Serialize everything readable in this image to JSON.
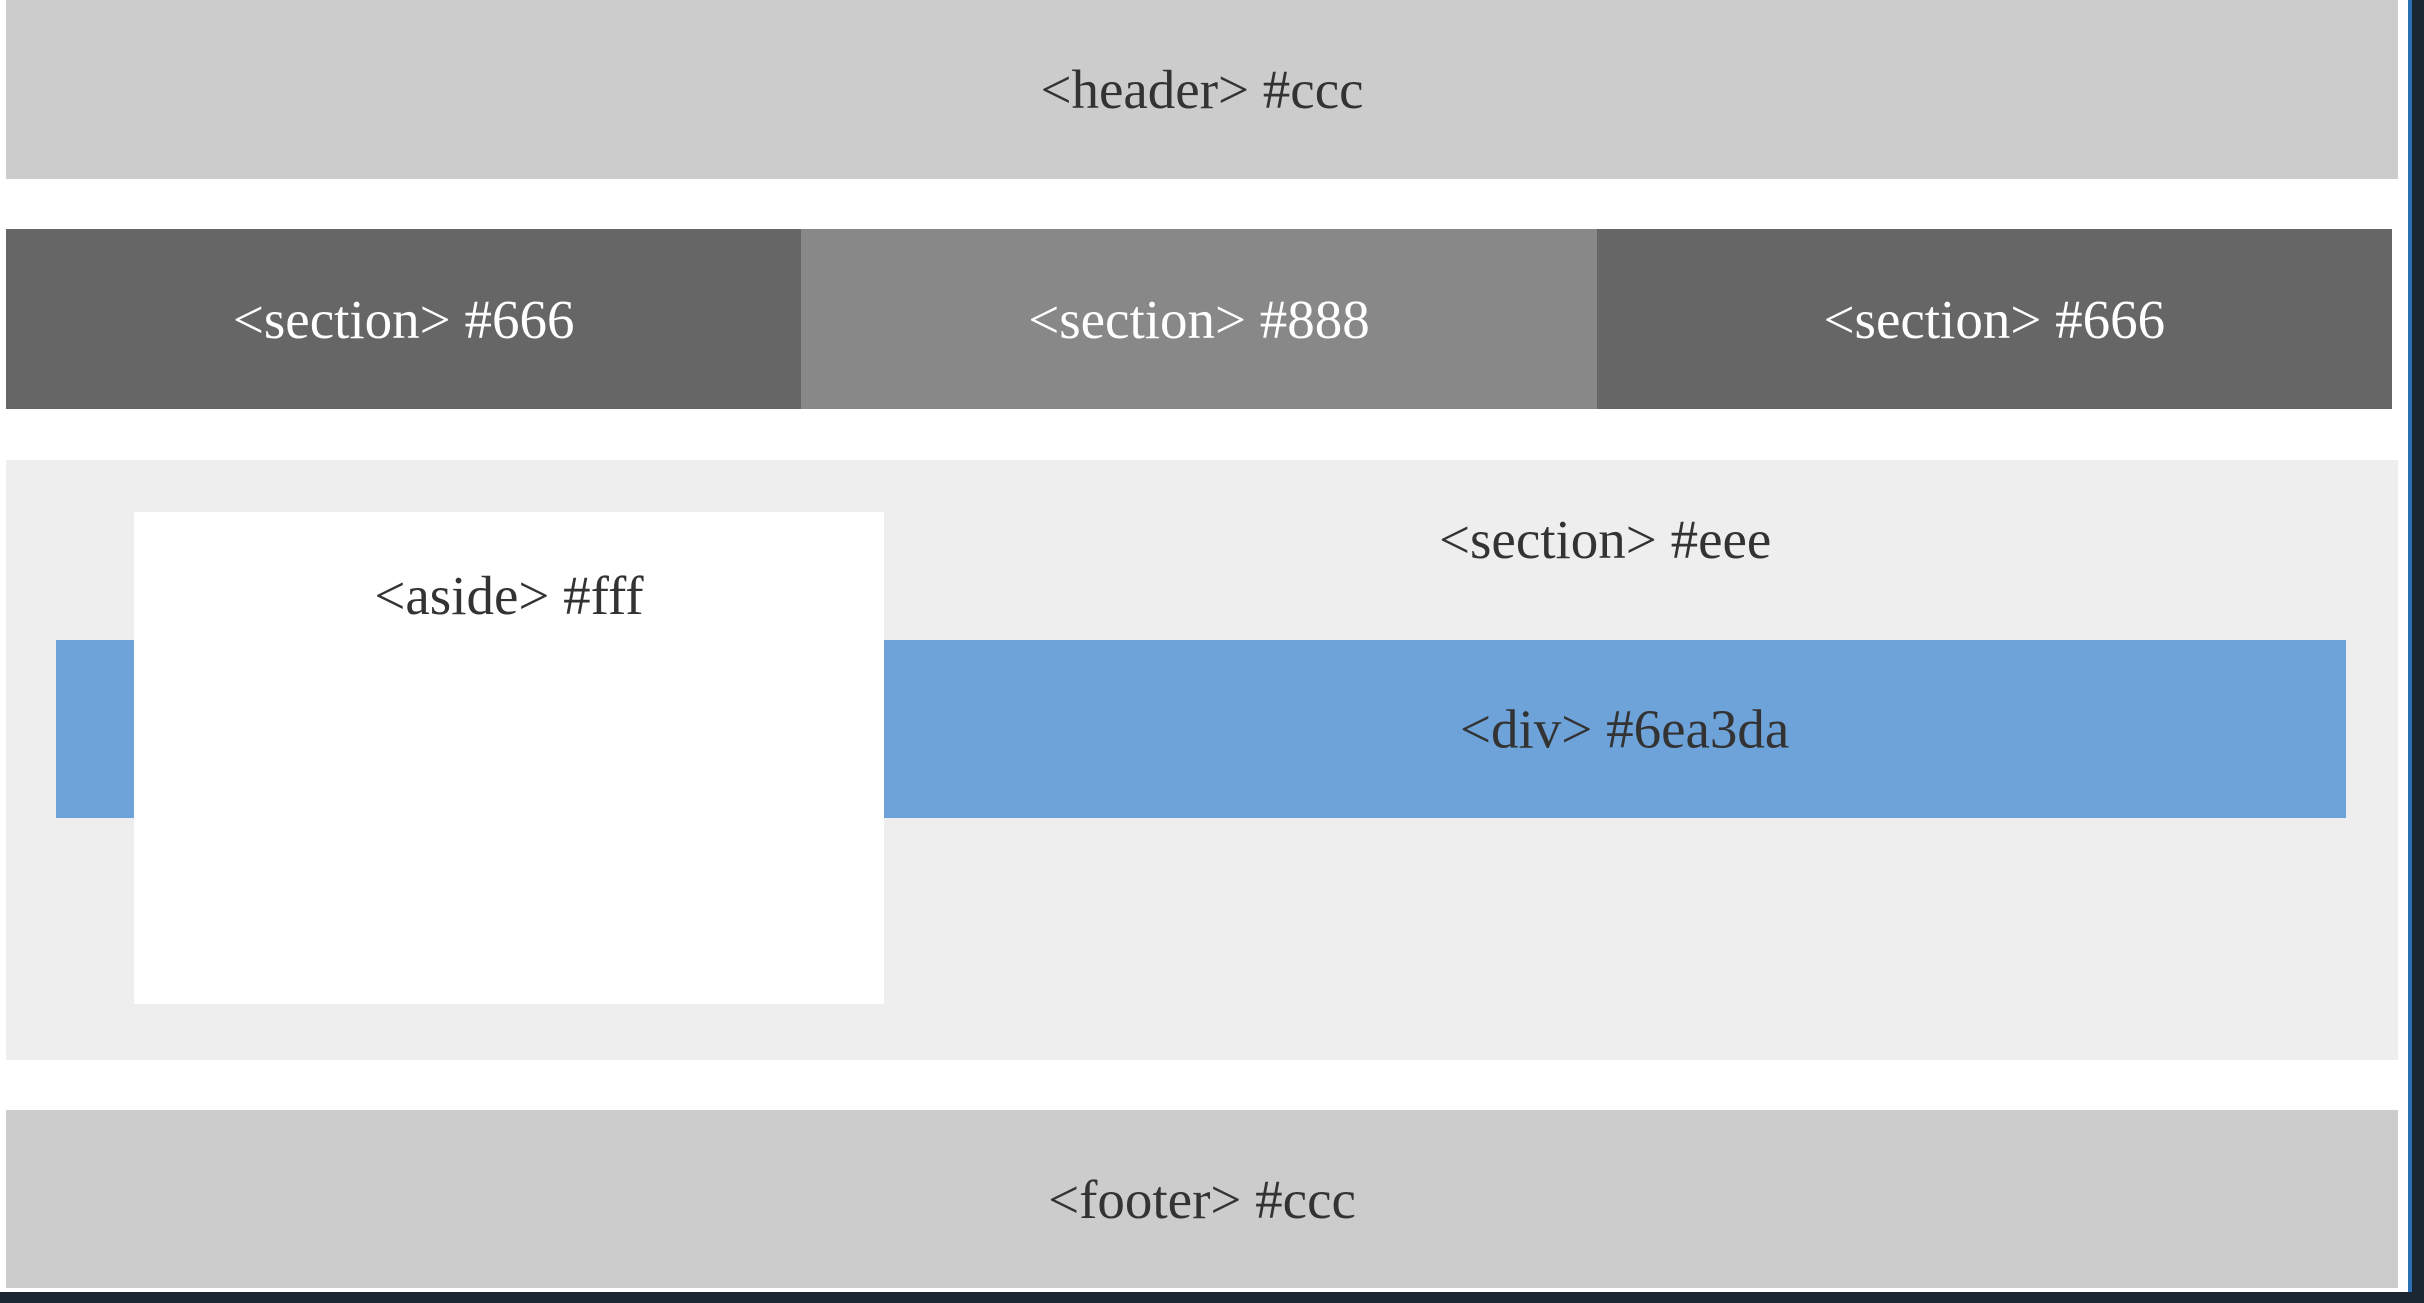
{
  "header": {
    "label": "<header> #ccc",
    "color": "#cccccc"
  },
  "sections_row": [
    {
      "label": "<section> #666",
      "color": "#666666"
    },
    {
      "label": "<section> #888",
      "color": "#888888"
    },
    {
      "label": "<section> #666",
      "color": "#666666"
    }
  ],
  "main_section": {
    "label": "<section> #eee",
    "color": "#eeeeee"
  },
  "div_bar": {
    "label": "<div> #6ea3da",
    "color": "#6ea3da"
  },
  "aside": {
    "label": "<aside> #fff",
    "color": "#ffffff"
  },
  "footer": {
    "label": "<footer> #ccc",
    "color": "#cccccc"
  }
}
